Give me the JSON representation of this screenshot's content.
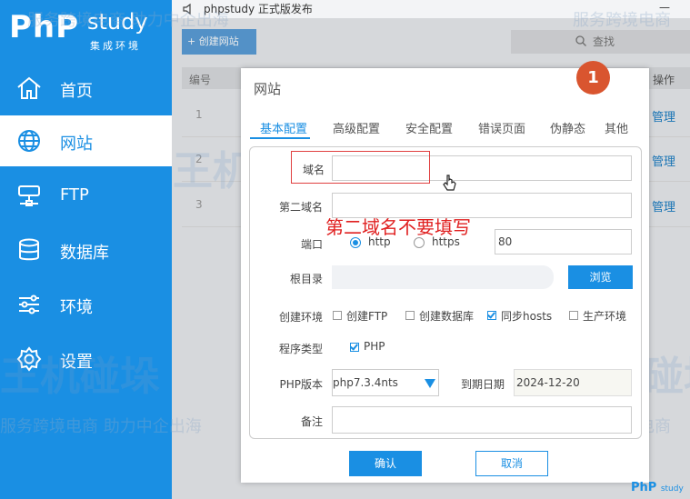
{
  "app": {
    "logo_main": "PhP",
    "logo_study": "study",
    "logo_sub": "集成环境",
    "window_title": "phpstudy 正式版发布",
    "minimize": "—"
  },
  "sidebar": {
    "items": [
      {
        "label": "首页",
        "icon": "home-icon"
      },
      {
        "label": "网站",
        "icon": "globe-icon"
      },
      {
        "label": "FTP",
        "icon": "server-icon"
      },
      {
        "label": "数据库",
        "icon": "database-icon"
      },
      {
        "label": "环境",
        "icon": "sliders-icon"
      },
      {
        "label": "设置",
        "icon": "gear-icon"
      }
    ],
    "active_index": 1
  },
  "toolbar": {
    "create_label": "+ 创建网站",
    "search_label": "查找"
  },
  "table": {
    "col_number": "编号",
    "col_action": "操作",
    "rows": [
      {
        "number": "1",
        "action": "管理"
      },
      {
        "number": "2",
        "action": "管理"
      },
      {
        "number": "3",
        "action": "管理"
      }
    ]
  },
  "dialog": {
    "title": "网站",
    "tabs": [
      "基本配置",
      "高级配置",
      "安全配置",
      "错误页面",
      "伪静态",
      "其他"
    ],
    "active_tab": 0,
    "fields": {
      "domain_label": "域名",
      "second_domain_label": "第二域名",
      "port_label": "端口",
      "protocol_http": "http",
      "protocol_https": "https",
      "port_value": "80",
      "root_label": "根目录",
      "browse_label": "浏览",
      "env_label": "创建环境",
      "env_options": [
        "创建FTP",
        "创建数据库",
        "同步hosts",
        "生产环境"
      ],
      "env_checked": [
        false,
        false,
        true,
        false
      ],
      "type_label": "程序类型",
      "type_option": "PHP",
      "php_label": "PHP版本",
      "php_value": "php7.3.4nts",
      "expire_label": "到期日期",
      "expire_value": "2024-12-20",
      "remark_label": "备注"
    },
    "confirm_label": "确认",
    "cancel_label": "取消"
  },
  "annotation": {
    "badge": "1",
    "note": "第二域名不要填写"
  },
  "watermark": {
    "text": "服务跨境电商 助力中企出海",
    "text_short": "服务跨境电商",
    "big": "王机碰垛"
  },
  "footer_logo": {
    "main": "PhP",
    "study": "study"
  },
  "colors": {
    "primary": "#1a8fe3",
    "annotation_red": "#e02020",
    "badge": "#d9552f"
  }
}
